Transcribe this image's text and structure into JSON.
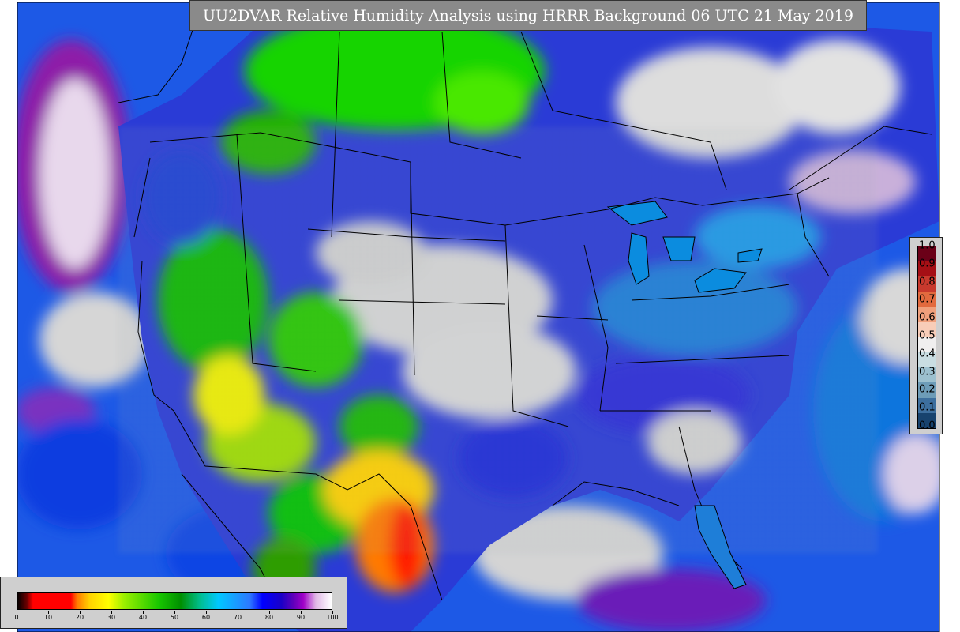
{
  "title": "UU2DVAR Relative Humidity Analysis using HRRR Background 06 UTC 21 May 2019",
  "rh_colorbar": {
    "labels": [
      "0",
      "10",
      "20",
      "30",
      "40",
      "50",
      "60",
      "70",
      "80",
      "90",
      "100"
    ],
    "range": [
      0,
      100
    ]
  },
  "diff_colorbar": {
    "labels": [
      "1.0",
      "0.9",
      "0.8",
      "0.7",
      "0.6",
      "0.5",
      "0.4",
      "0.3",
      "0.2",
      "0.1",
      "0.0"
    ],
    "colors": [
      "#6b0018",
      "#a50f15",
      "#c8392d",
      "#e26a3e",
      "#f0a07c",
      "#f8cdb8",
      "#f0efef",
      "#c9dde2",
      "#9cc0cf",
      "#6d9cb8",
      "#3d6f9e",
      "#17436e"
    ]
  },
  "colors": {
    "ocean": "#0a4cd8",
    "dry_interior": "#d2d2d2",
    "very_dry": "#ff1a00",
    "moist_west": "#18c700",
    "boundaries": "#000000"
  }
}
